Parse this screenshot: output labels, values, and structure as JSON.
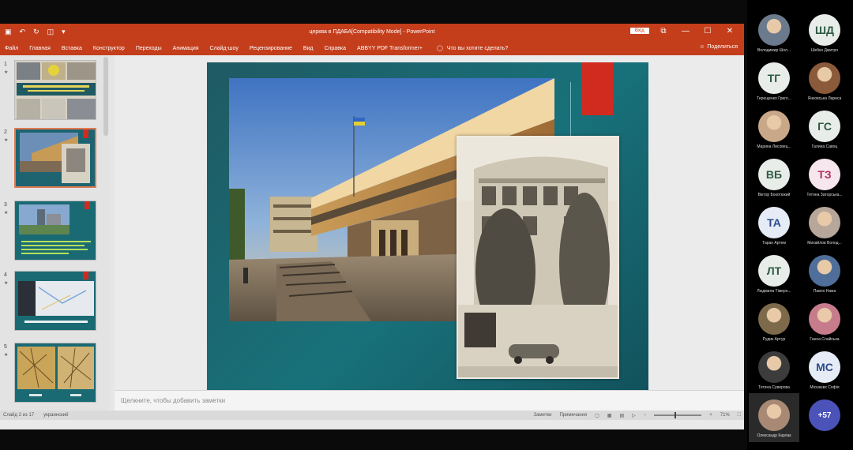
{
  "window": {
    "doc_title": "церква в ПДАБА[Compatibility Mode] - PowerPoint",
    "signin_label": "Вхід",
    "controls": [
      "⧉",
      "—",
      "☐",
      "✕"
    ]
  },
  "ribbon": {
    "tabs": [
      "Файл",
      "Главная",
      "Вставка",
      "Конструктор",
      "Переходы",
      "Анимация",
      "Слайд-шоу",
      "Рецензирование",
      "Вид",
      "Справка",
      "ABBYY PDF Transformer+"
    ],
    "search_placeholder": "Что вы хотите сделать?",
    "share_label": "Поделиться"
  },
  "thumbnails": [
    {
      "num": "1",
      "star": "★",
      "active": false
    },
    {
      "num": "2",
      "star": "★",
      "active": true
    },
    {
      "num": "3",
      "star": "★",
      "active": false
    },
    {
      "num": "4",
      "star": "★",
      "active": false
    },
    {
      "num": "5",
      "star": "★",
      "active": false
    }
  ],
  "notes_placeholder": "Щелкните, чтобы добавить заметки",
  "status": {
    "slide_counter": "Слайд 2 из 17",
    "language": "украинский",
    "notes_btn": "Заметки",
    "comments_btn": "Примечания",
    "zoom": "71%"
  },
  "participants": [
    {
      "initials": "",
      "name": "Володимир Шол...",
      "kind": "photo",
      "color": "#6b7a8c"
    },
    {
      "initials": "ШД",
      "name": "Шебко Дмитро",
      "kind": "init"
    },
    {
      "initials": "ТГ",
      "name": "Терещенко Григо...",
      "kind": "init"
    },
    {
      "initials": "",
      "name": "Янковська Лариса",
      "kind": "photo",
      "color": "#8a5a3a"
    },
    {
      "initials": "",
      "name": "Марина Лисовец...",
      "kind": "photo",
      "color": "#c9a889"
    },
    {
      "initials": "ГС",
      "name": "Галина Савоц",
      "kind": "init"
    },
    {
      "initials": "ВБ",
      "name": "Віктор Бокотюкий",
      "kind": "init"
    },
    {
      "initials": "ТЗ",
      "name": "Тетяна Заторська...",
      "kind": "init-pink"
    },
    {
      "initials": "ТА",
      "name": "Таран Артем",
      "kind": "init-blue"
    },
    {
      "initials": "",
      "name": "Михайлов Волод...",
      "kind": "photo",
      "color": "#b7a79a"
    },
    {
      "initials": "ЛТ",
      "name": "Людмила Тімерн...",
      "kind": "init"
    },
    {
      "initials": "",
      "name": "Павло Нажа",
      "kind": "photo",
      "color": "#4f6f9a"
    },
    {
      "initials": "",
      "name": "Рудик Артур",
      "kind": "photo",
      "color": "#7c6a4a"
    },
    {
      "initials": "",
      "name": "Ганна Слайська",
      "kind": "photo",
      "color": "#c77c8c"
    },
    {
      "initials": "",
      "name": "Тетяна Сувирова",
      "kind": "photo",
      "color": "#3c3c3c"
    },
    {
      "initials": "МС",
      "name": "Місюкєвх Софія",
      "kind": "init-blue"
    },
    {
      "initials": "",
      "name": "Олександр Карлак",
      "kind": "photo-active",
      "color": "#a88a74"
    },
    {
      "initials": "+57",
      "name": "",
      "kind": "more"
    }
  ],
  "colors": {
    "ppt_accent": "#c43e1c",
    "slide_bg": "#18717a",
    "slide_red": "#d12a1e"
  }
}
